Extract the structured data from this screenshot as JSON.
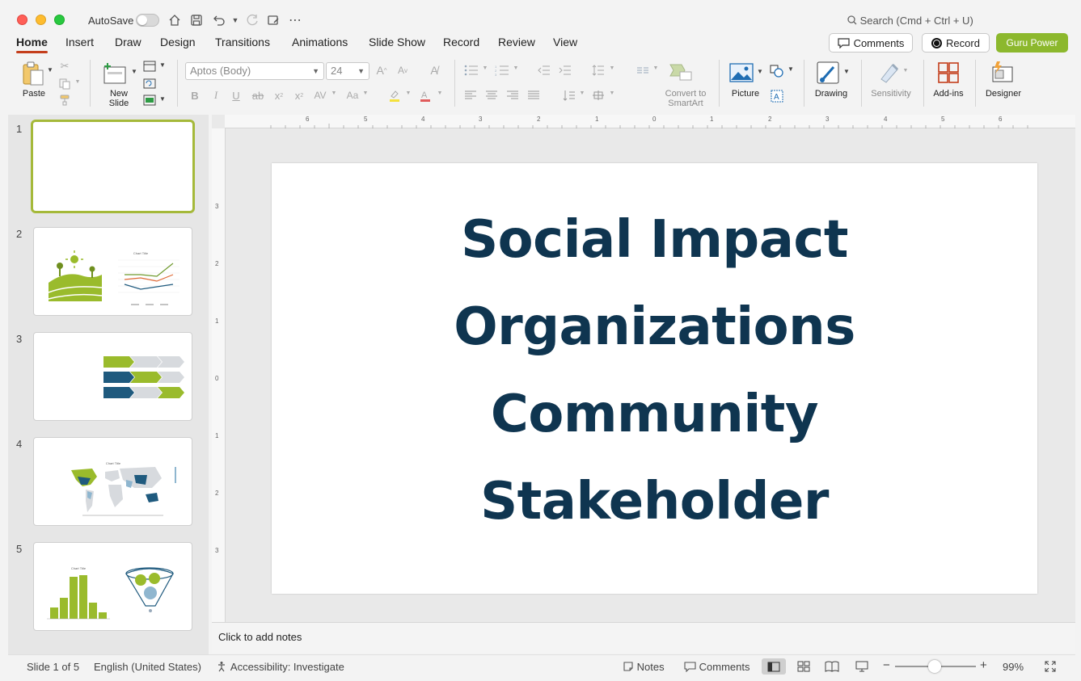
{
  "titlebar": {
    "autosave_label": "AutoSave",
    "search_placeholder": "Search (Cmd + Ctrl + U)"
  },
  "tabs": [
    "Home",
    "Insert",
    "Draw",
    "Design",
    "Transitions",
    "Animations",
    "Slide Show",
    "Record",
    "Review",
    "View"
  ],
  "header_buttons": {
    "comments": "Comments",
    "record": "Record",
    "guru": "Guru Power"
  },
  "ribbon": {
    "paste": "Paste",
    "new_slide_line1": "New",
    "new_slide_line2": "Slide",
    "font_name": "Aptos (Body)",
    "font_size": "24",
    "convert_line1": "Convert to",
    "convert_line2": "SmartArt",
    "picture": "Picture",
    "drawing": "Drawing",
    "sensitivity": "Sensitivity",
    "addins": "Add-ins",
    "designer": "Designer"
  },
  "slides": {
    "numbers": [
      "1",
      "2",
      "3",
      "4",
      "5"
    ],
    "thumb_chart_title": "Chart Title"
  },
  "slide": {
    "lines": [
      "Social Impact",
      "Organizations",
      "Community",
      "Stakeholder"
    ]
  },
  "notes": {
    "placeholder": "Click to add notes"
  },
  "status": {
    "slide_of": "Slide 1 of 5",
    "language": "English (United States)",
    "accessibility": "Accessibility: Investigate",
    "notes": "Notes",
    "comments": "Comments",
    "zoom": "99%"
  },
  "colors": {
    "accent_green": "#8cb82d",
    "title_navy": "#0f3550",
    "chevron_blue": "#1f5a7e",
    "tab_underline": "#c43e1c"
  }
}
